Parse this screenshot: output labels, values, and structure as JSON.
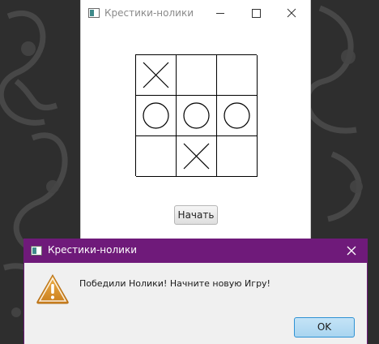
{
  "main_window": {
    "title": "Крестики-нолики",
    "board": {
      "cells": [
        "X",
        "",
        "",
        "O",
        "O",
        "O",
        "",
        "X",
        ""
      ]
    },
    "start_button_label": "Начать"
  },
  "dialog": {
    "title": "Крестики-нолики",
    "message": "Победили Нолики! Начните новую Игру!",
    "ok_button_label": "OK"
  },
  "colors": {
    "dialog_title_bar": "#6f1a7a",
    "warning_icon": "#d9912b",
    "ok_button_border": "#2e92d4"
  },
  "icons": {
    "app": "app-window-icon",
    "warning": "warning-triangle-icon",
    "minimize": "minimize-icon",
    "maximize": "maximize-icon",
    "close": "close-icon"
  }
}
